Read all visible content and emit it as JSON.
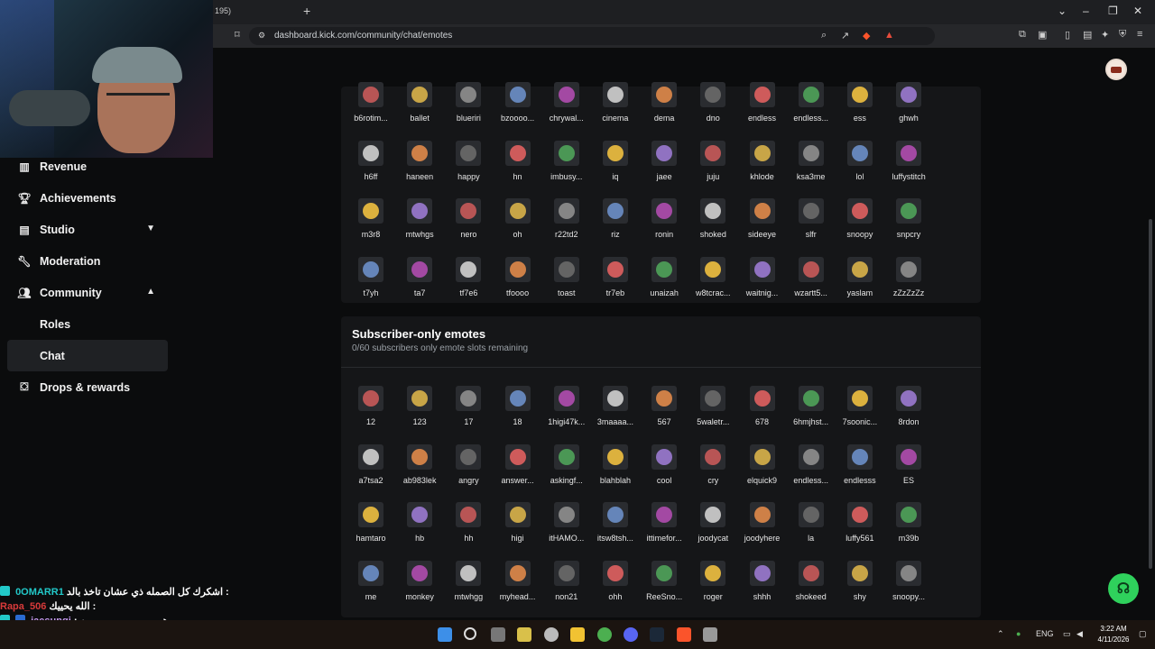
{
  "browser": {
    "tab_fragment": "195)",
    "new_tab": "+",
    "url": "dashboard.kick.com/community/chat/emotes"
  },
  "sidebar": {
    "items": [
      {
        "label": "Revenue",
        "icon": "chart-icon"
      },
      {
        "label": "Achievements",
        "icon": "trophy-icon"
      },
      {
        "label": "Studio",
        "icon": "studio-icon",
        "chevron": "down"
      },
      {
        "label": "Moderation",
        "icon": "wrench-icon"
      },
      {
        "label": "Community",
        "icon": "users-icon",
        "chevron": "up"
      },
      {
        "label": "Roles"
      },
      {
        "label": "Chat",
        "active": true
      },
      {
        "label": "Drops & rewards",
        "icon": "drops-icon"
      }
    ]
  },
  "channel_emotes": {
    "rows": [
      [
        "b6rotim...",
        "ballet",
        "blueriri",
        "bzoooo...",
        "chrywal...",
        "cinema",
        "dema",
        "dno",
        "endless",
        "endless...",
        "ess",
        "ghwh"
      ],
      [
        "h6ff",
        "haneen",
        "happy",
        "hn",
        "imbusy...",
        "iq",
        "jaee",
        "juju",
        "khlode",
        "ksa3me",
        "lol",
        "luffystitch"
      ],
      [
        "m3r8",
        "mtwhgs",
        "nero",
        "oh",
        "r22td2",
        "riz",
        "ronin",
        "shoked",
        "sideeye",
        "slfr",
        "snoopy",
        "snpcry"
      ],
      [
        "t7yh",
        "ta7",
        "tf7e6",
        "tfoooo",
        "toast",
        "tr7eb",
        "unaizah",
        "w8tcrac...",
        "waitnig...",
        "wzartt5...",
        "yaslam",
        "zZzZzZz"
      ]
    ]
  },
  "subscriber_emotes": {
    "title": "Subscriber-only emotes",
    "subtitle": "0/60 subscribers only emote slots remaining",
    "rows": [
      [
        "12",
        "123",
        "17",
        "18",
        "1higi47k...",
        "3maaaa...",
        "567",
        "5waletr...",
        "678",
        "6hmjhst...",
        "7soonic...",
        "8rdon"
      ],
      [
        "a7tsa2",
        "ab983lek",
        "angry",
        "answer...",
        "askingf...",
        "blahblah",
        "cool",
        "cry",
        "elquick9",
        "endless...",
        "endlesss",
        "ES"
      ],
      [
        "hamtaro",
        "hb",
        "hh",
        "higi",
        "itHAMO...",
        "itsw8tsh...",
        "ittimefor...",
        "joodycat",
        "joodyhere",
        "la",
        "luffy561",
        "m39b"
      ],
      [
        "me",
        "monkey",
        "mtwhgg",
        "myhead...",
        "non21",
        "ohh",
        "ReeSno...",
        "roger",
        "shhh",
        "shokeed",
        "shy",
        "snoopy..."
      ]
    ]
  },
  "chat_overlay": [
    {
      "user": "0OMARR1",
      "message": "اشكرك كل الصمله ذي عشان تاخذ بالد :",
      "user_color": "#22c9c9"
    },
    {
      "user": "Rapa_506",
      "message": "الله يحييك :",
      "user_color": "#d83a3a"
    },
    {
      "user": "jaesungi",
      "message": ": ههههههههههههههههههه",
      "user_color": "#c79bf2"
    }
  ],
  "taskbar": {
    "language": "ENG",
    "time": "3:22 AM",
    "date": "4/11/2026"
  },
  "colors": {
    "accent_green": "#2fd15c",
    "panel_bg": "#151618",
    "page_bg": "#0b0c0d"
  }
}
